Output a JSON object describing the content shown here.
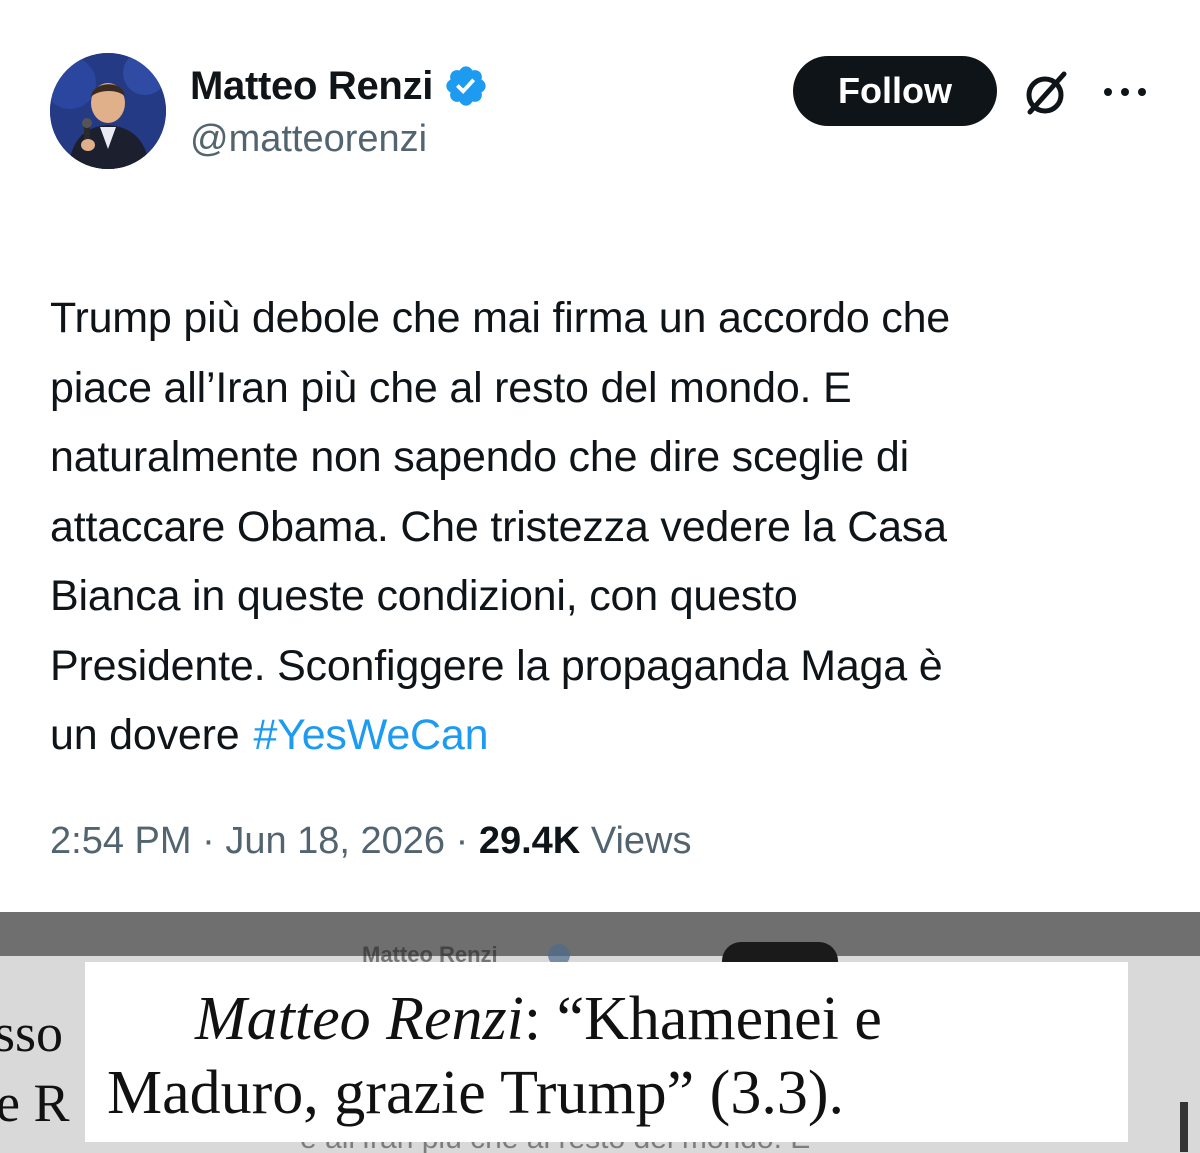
{
  "tweet": {
    "author_name": "Matteo Renzi",
    "author_handle": "@matteorenzi",
    "follow_label": "Follow",
    "text_lines": [
      "Trump più debole che mai firma un accordo che",
      "piace all’Iran più che al resto del mondo. E",
      "naturalmente non sapendo che dire sceglie di",
      "attaccare Obama. Che tristezza vedere la Casa",
      "Bianca in queste condizioni, con questo",
      "Presidente. Sconfiggere la propaganda Maga è",
      "un dovere"
    ],
    "hashtag": "#YesWeCan",
    "time": "2:54 PM",
    "separator": "·",
    "date": "Jun 18, 2026",
    "views_count": "29.4K",
    "views_label": "Views",
    "colors": {
      "text": "#0f1419",
      "secondary": "#536471",
      "link": "#1d9bf0",
      "verified": "#1d9bf0"
    },
    "icons": [
      "verified-badge-icon",
      "grok-icon",
      "more-icon"
    ]
  },
  "overlay": {
    "ghost_name": "Matteo Renzi",
    "ghost_left_1": "sso",
    "ghost_left_2": "e R",
    "ghost_bottom": "e all’Iran più che al resto del mondo. E",
    "caption_speaker": "Matteo Renzi",
    "caption_line1_rest": ": “Khamenei e",
    "caption_line2": "Maduro, grazie Trump” (3.3)."
  }
}
